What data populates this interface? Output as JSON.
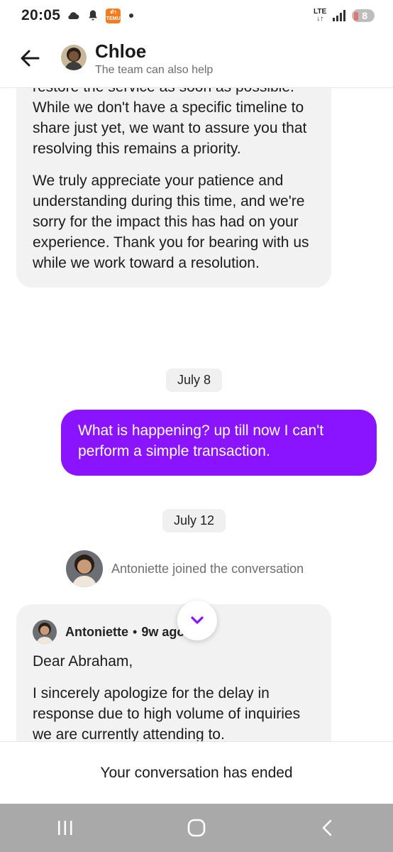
{
  "status_bar": {
    "time": "20:05",
    "app_badge_top": "ดำ",
    "app_badge_bottom": "TEMU",
    "network_top": "LTE",
    "network_bottom": "↓↑",
    "battery": "8"
  },
  "header": {
    "name": "Chloe",
    "subtitle": "The team can also help"
  },
  "messages": {
    "first_paragraph": "restore the service as soon as possible. While we don't have a specific timeline to share just yet, we want to assure you that resolving this remains a priority.",
    "second_paragraph": "We truly appreciate your patience and understanding during this time, and we're sorry for the impact this has had on your experience. Thank you for bearing with us while we work toward a resolution.",
    "date_1": "July 8",
    "user_message": "What is happening? up till now I can't perform a simple transaction.",
    "date_2": "July 12",
    "join_notice": "Antoniette joined the conversation",
    "agent_name": "Antoniette",
    "agent_separator": "•",
    "agent_time": "9w ago",
    "agent_greeting": "Dear Abraham,",
    "agent_body": "I sincerely apologize for the delay in response due to high volume of inquiries we are currently attending to."
  },
  "footer": {
    "ended_text": "Your conversation has ended"
  },
  "colors": {
    "accent": "#8a14ff",
    "bubble_in": "#f2f2f2",
    "nav_bar": "#a9a9a9"
  },
  "icons": {
    "back": "arrow-left-icon",
    "scroll": "chevron-down-icon",
    "nav_recent": "recent-apps-icon",
    "nav_home": "home-icon",
    "nav_back": "back-chevron-icon"
  }
}
